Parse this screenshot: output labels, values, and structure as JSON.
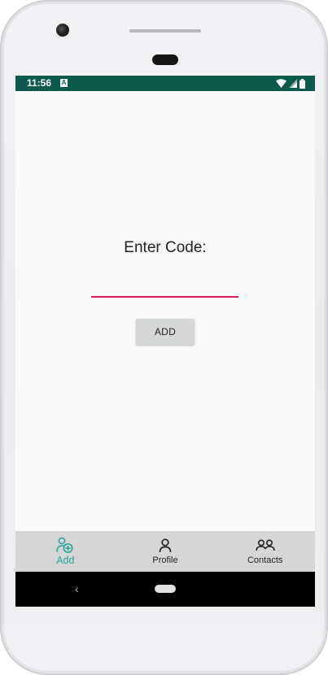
{
  "status_bar": {
    "time": "11:56",
    "notification_badge": "A",
    "background_color": "#0b5a4b",
    "icons": [
      "wifi-icon",
      "signal-icon",
      "battery-icon"
    ]
  },
  "main": {
    "prompt_label": "Enter Code:",
    "code_input": {
      "value": "",
      "placeholder": ""
    },
    "add_button_label": "ADD",
    "underline_color": "#d81b60"
  },
  "bottom_nav": {
    "active_color": "#26a69a",
    "items": [
      {
        "label": "Add",
        "icon": "add-user-icon",
        "active": true
      },
      {
        "label": "Profile",
        "icon": "person-icon",
        "active": false
      },
      {
        "label": "Contacts",
        "icon": "group-icon",
        "active": false
      }
    ]
  },
  "system_nav": {
    "back_glyph": "‹",
    "icons": [
      "back-icon",
      "home-icon"
    ]
  }
}
